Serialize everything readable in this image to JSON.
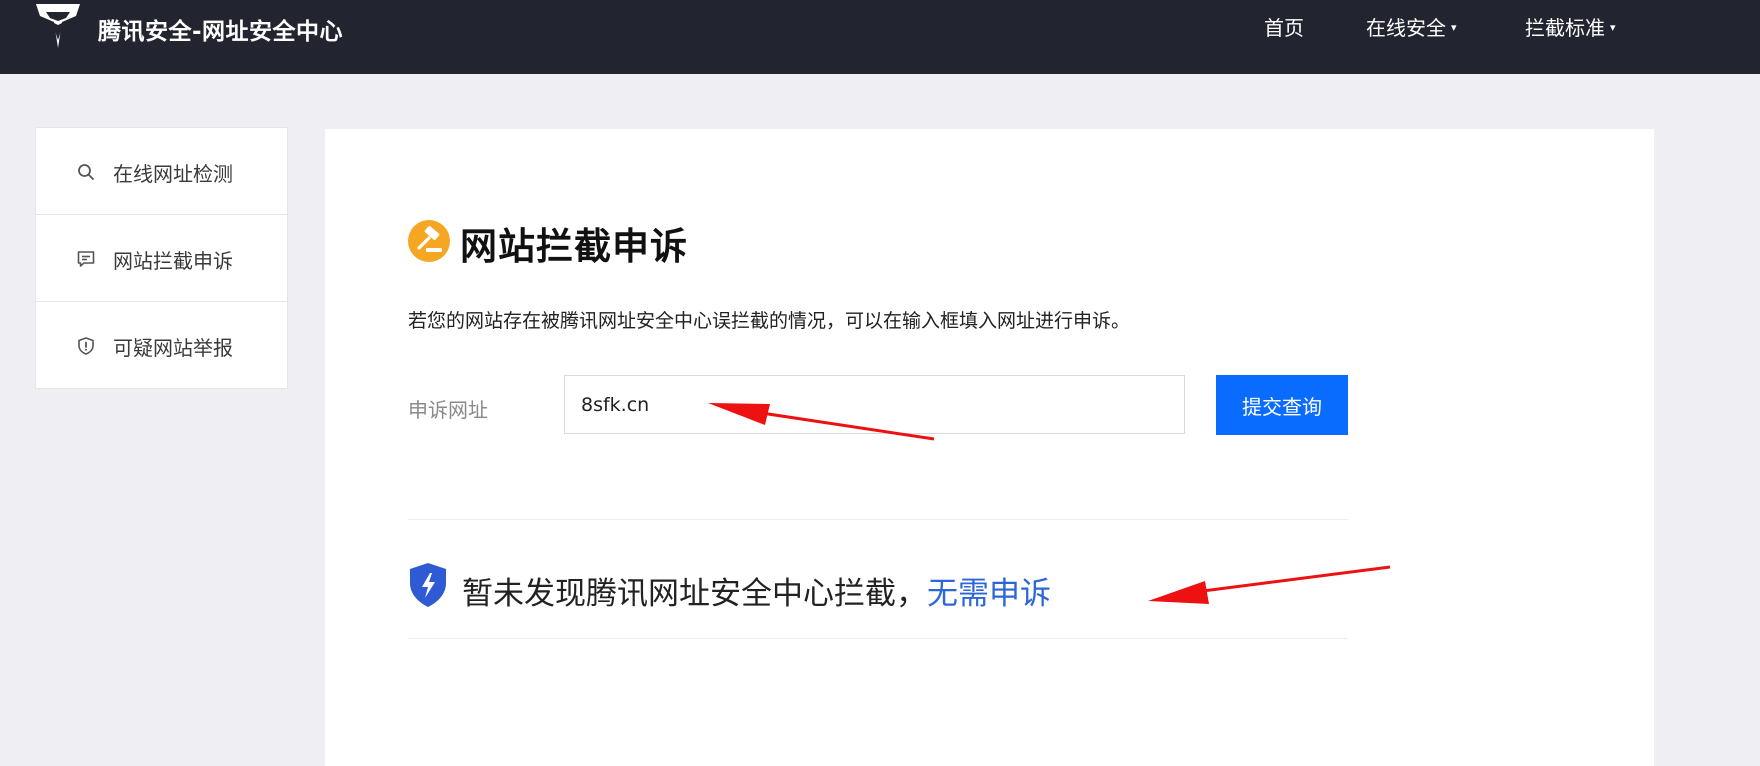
{
  "app": {
    "brand_name": "腾讯安全-网址安全中心"
  },
  "nav": {
    "items": [
      {
        "label": "首页",
        "has_dropdown": false
      },
      {
        "label": "在线安全",
        "has_dropdown": true
      },
      {
        "label": "拦截标准",
        "has_dropdown": true
      }
    ],
    "caret": "▾"
  },
  "sidebar": {
    "items": [
      {
        "label": "在线网址检测",
        "icon": "search-icon"
      },
      {
        "label": "网站拦截申诉",
        "icon": "chat-icon"
      },
      {
        "label": "可疑网站举报",
        "icon": "shield-alert-icon"
      }
    ]
  },
  "main": {
    "title": "网站拦截申诉",
    "title_icon": "gavel-icon",
    "description": "若您的网站存在被腾讯网址安全中心误拦截的情况，可以在输入框填入网址进行申诉。",
    "field_label": "申诉网址",
    "url_value": "8sfk.cn",
    "submit_label": "提交查询",
    "result_prefix": "暂未发现腾讯网址安全中心拦截，",
    "result_link": "无需申诉",
    "result_icon": "shield-bolt-icon"
  },
  "colors": {
    "topbar": "#222530",
    "accent_blue": "#0a6cff",
    "link_blue": "#2d66d6",
    "title_icon_orange": "#f5a623",
    "shield_blue": "#2e5bd3",
    "annotation_red": "#ee1111"
  }
}
